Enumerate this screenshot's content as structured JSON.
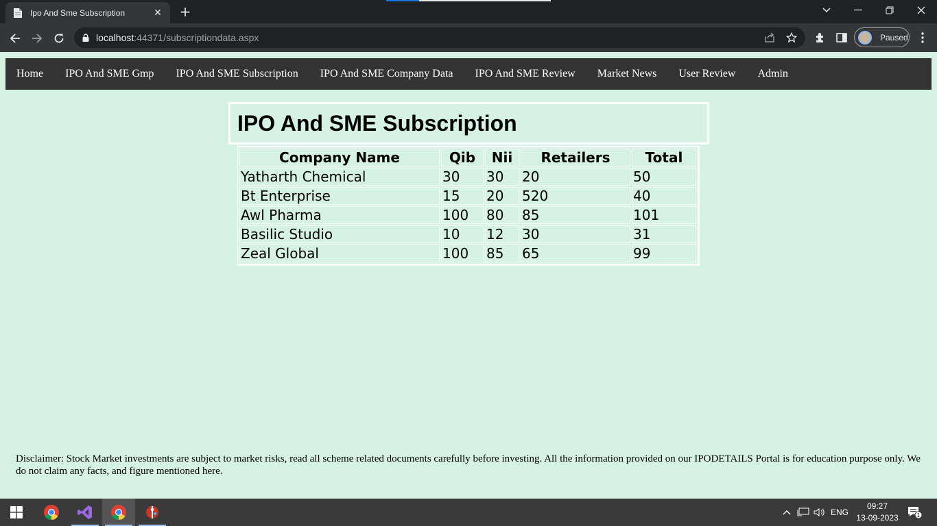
{
  "browser": {
    "tab_title": "Ipo And Sme Subscription",
    "url_host": "localhost",
    "url_rest": ":44371/subscriptiondata.aspx",
    "profile_label": "Paused"
  },
  "nav": {
    "items": [
      "Home",
      "IPO And SME Gmp",
      "IPO And SME Subscription",
      "IPO And SME Company Data",
      "IPO And SME Review",
      "Market News",
      "User Review",
      "Admin"
    ]
  },
  "page": {
    "heading": "IPO And SME Subscription",
    "disclaimer": "Disclaimer: Stock Market investments are subject to market risks, read all scheme related documents carefully before investing. All the information provided on our IPODETAILS Portal is for education purpose only. We do not claim any facts, and figure mentioned here."
  },
  "table": {
    "headers": [
      "Company Name",
      "Qib",
      "Nii",
      "Retailers",
      "Total"
    ],
    "rows": [
      [
        "Yatharth Chemical",
        "30",
        "30",
        "20",
        "50"
      ],
      [
        "Bt Enterprise",
        "15",
        "20",
        "520",
        "40"
      ],
      [
        "Awl Pharma",
        "100",
        "80",
        "85",
        "101"
      ],
      [
        "Basilic Studio",
        "10",
        "12",
        "30",
        "31"
      ],
      [
        "Zeal Global",
        "100",
        "85",
        "65",
        "99"
      ]
    ]
  },
  "taskbar": {
    "lang": "ENG",
    "time": "09:27",
    "date": "13-09-2023",
    "notification_count": "1"
  },
  "colors": {
    "page_bg": "#d6f2e5",
    "navbar_bg": "#333333",
    "chrome_dark": "#202124",
    "chrome_toolbar": "#35363a"
  }
}
